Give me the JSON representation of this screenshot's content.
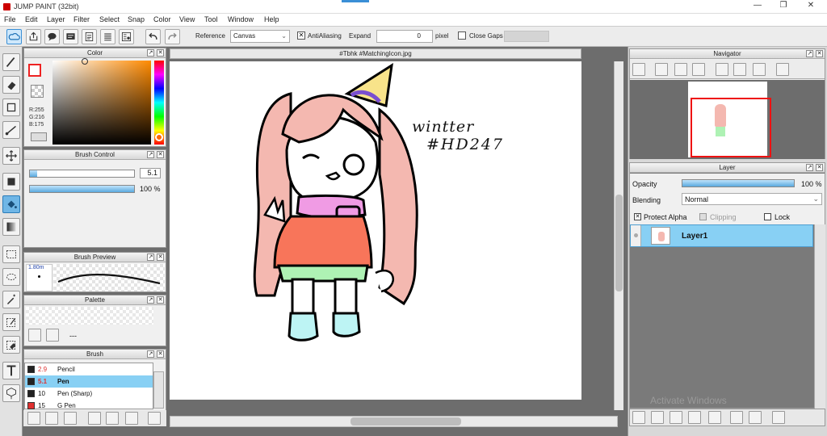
{
  "app": {
    "title": "JUMP PAINT (32bit)"
  },
  "window_controls": {
    "minimize": "—",
    "maximize": "❐",
    "close": "✕"
  },
  "menu": [
    "File",
    "Edit",
    "Layer",
    "Filter",
    "Select",
    "Snap",
    "Color",
    "View",
    "Tool",
    "Window",
    "Help"
  ],
  "toolbar": {
    "reference_label": "Reference",
    "reference_value": "Canvas",
    "antialiasing_label": "AntiAliasing",
    "expand_label": "Expand",
    "expand_value": "0",
    "pixel_label": "pixel",
    "close_gaps_label": "Close Gaps"
  },
  "color_panel": {
    "title": "Color",
    "r": "R:255",
    "g": "G:216",
    "b": "B:175"
  },
  "brush_control": {
    "title": "Brush Control",
    "size_value": "5.1",
    "opacity_value": "100 %",
    "opacity": 1.0
  },
  "brush_preview": {
    "title": "Brush Preview",
    "size": "1.80m"
  },
  "palette": {
    "title": "Palette",
    "placeholder": "---"
  },
  "brush_panel": {
    "title": "Brush",
    "items": [
      {
        "size": "2.9",
        "name": "Pencil",
        "color": "#222222"
      },
      {
        "size": "5.1",
        "name": "Pen",
        "color": "#222222"
      },
      {
        "size": "10",
        "name": "Pen (Sharp)",
        "color": "#222222"
      },
      {
        "size": "15",
        "name": "G Pen",
        "color": "#e03030"
      }
    ]
  },
  "document": {
    "tab": "#Tbhk #MatchingIcon.jpg"
  },
  "artwork": {
    "handwriting_line1": "wintter",
    "handwriting_line2": "#HD247"
  },
  "navigator": {
    "title": "Navigator"
  },
  "layer_panel": {
    "title": "Layer",
    "opacity_label": "Opacity",
    "opacity_value": "100 %",
    "opacity": 1.0,
    "blending_label": "Blending",
    "blending_value": "Normal",
    "protect_alpha": "Protect Alpha",
    "clipping": "Clipping",
    "lock": "Lock",
    "layers": [
      {
        "name": "Layer1"
      }
    ]
  },
  "watermark": "Activate Windows",
  "colors": {
    "accent": "#6fb6e6",
    "selection": "#88d0f4",
    "hair": "#f4b8b0",
    "skirt": "#f8755a",
    "scarf": "#f09be4",
    "shorts": "#aef2b4",
    "socks": "#bdf4f4"
  }
}
